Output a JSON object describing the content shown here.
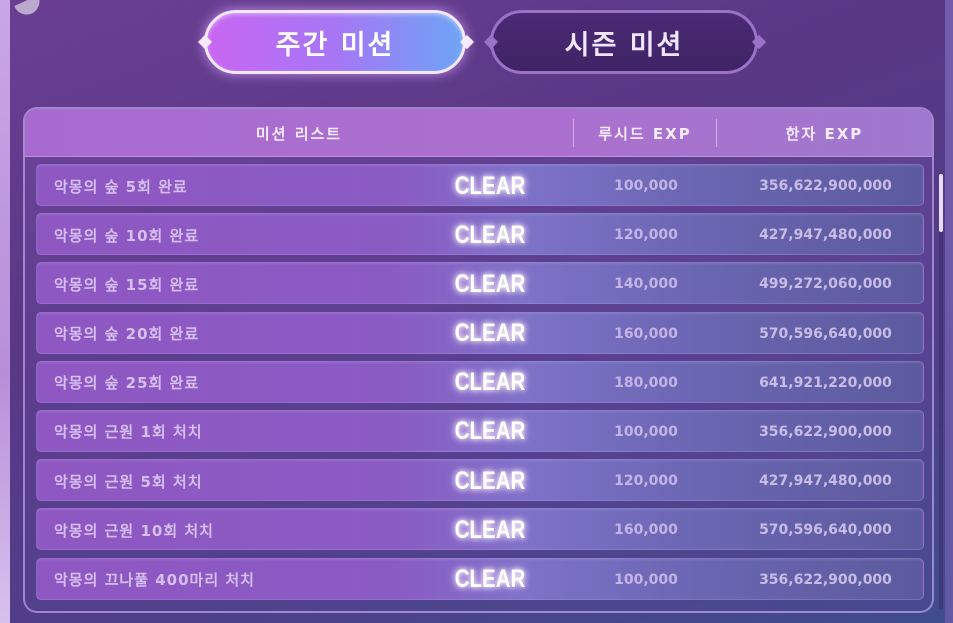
{
  "tabs": {
    "weekly": "주간 미션",
    "season": "시즌 미션"
  },
  "table": {
    "headers": {
      "mission_list": "미션 리스트",
      "lucid_exp": "루시드 EXP",
      "hanja_exp": "한자 EXP"
    },
    "rows": [
      {
        "name": "악몽의 숲 5회 완료",
        "status": "CLEAR",
        "lucid": "100,000",
        "hanja": "356,622,900,000"
      },
      {
        "name": "악몽의 숲 10회 완료",
        "status": "CLEAR",
        "lucid": "120,000",
        "hanja": "427,947,480,000"
      },
      {
        "name": "악몽의 숲 15회 완료",
        "status": "CLEAR",
        "lucid": "140,000",
        "hanja": "499,272,060,000"
      },
      {
        "name": "악몽의 숲 20회 완료",
        "status": "CLEAR",
        "lucid": "160,000",
        "hanja": "570,596,640,000"
      },
      {
        "name": "악몽의 숲 25회 완료",
        "status": "CLEAR",
        "lucid": "180,000",
        "hanja": "641,921,220,000"
      },
      {
        "name": "악몽의 근원 1회 처치",
        "status": "CLEAR",
        "lucid": "100,000",
        "hanja": "356,622,900,000"
      },
      {
        "name": "악몽의 근원 5회 처치",
        "status": "CLEAR",
        "lucid": "120,000",
        "hanja": "427,947,480,000"
      },
      {
        "name": "악몽의 근원 10회 처치",
        "status": "CLEAR",
        "lucid": "160,000",
        "hanja": "570,596,640,000"
      },
      {
        "name": "악몽의 끄나풀 400마리 처치",
        "status": "CLEAR",
        "lucid": "100,000",
        "hanja": "356,622,900,000"
      }
    ]
  },
  "colors": {
    "background": "#5a3886",
    "active_tab_start": "#c866f2",
    "active_tab_end": "#6ea4f5",
    "inactive_tab": "#4b2a74",
    "header": "#a76bd0",
    "clear_text": "#ffffff"
  }
}
